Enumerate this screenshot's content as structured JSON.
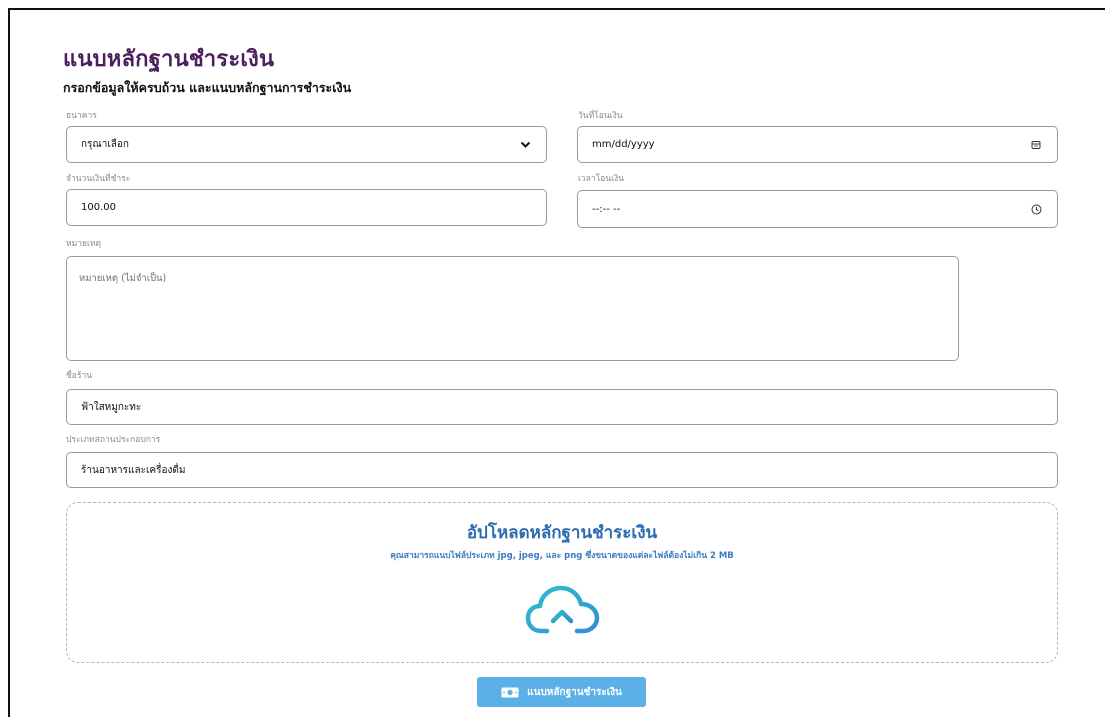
{
  "header": {
    "title": "แนบหลักฐานชำระเงิน",
    "subtitle": "กรอกข้อมูลให้ครบถ้วน และแนบหลักฐานการชำระเงิน"
  },
  "form": {
    "bank": {
      "label": "ธนาคาร",
      "value": "กรุณาเลือก"
    },
    "transfer_date": {
      "label": "วันที่โอนเงิน",
      "value": "mm/dd/yyyy"
    },
    "amount": {
      "label": "จำนวนเงินที่ชำระ",
      "value": "100.00"
    },
    "transfer_time": {
      "label": "เวลาโอนเงิน",
      "value": "--:-- --"
    },
    "note": {
      "label": "หมายเหตุ",
      "placeholder": "หมายเหตุ (ไม่จำเป็น)"
    },
    "shop_name": {
      "label": "ชื่อร้าน",
      "value": "ฟ้าใสหมูกะทะ"
    },
    "business_type": {
      "label": "ประเภทสถานประกอบการ",
      "value": "ร้านอาหารและเครื่องดื่ม"
    }
  },
  "upload": {
    "title": "อัปโหลดหลักฐานชำระเงิน",
    "description": "คุณสามารถแนบไฟล์ประเภท jpg, jpeg, และ png ซึ่งขนาดของแต่ละไฟล์ต้องไม่เกิน 2 MB",
    "icon": "cloud-upload-icon"
  },
  "submit": {
    "label": "แนบหลักฐานชำระเงิน",
    "icon": "money-icon"
  },
  "colors": {
    "title": "#4a1f5c",
    "upload_title": "#2d6bb0",
    "cloud_gradient_start": "#2fc0c8",
    "cloud_gradient_end": "#2f8fd6",
    "button": "#5bb0e8"
  }
}
